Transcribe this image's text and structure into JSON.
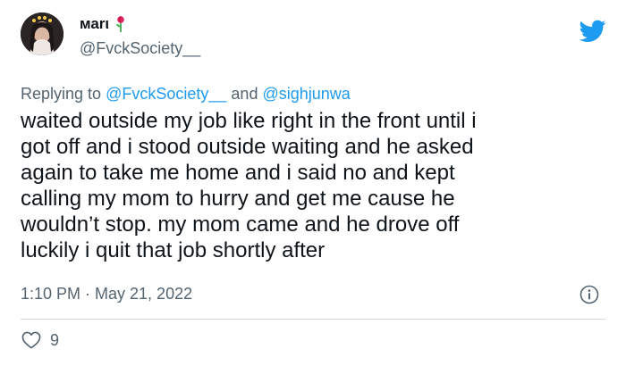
{
  "tweet": {
    "display_name": "маrι",
    "handle": "@FvckSociety__",
    "replying_prefix": "Replying to",
    "replying_to": [
      "@FvckSociety__",
      "and",
      "@sighjunwa"
    ],
    "text_lines": [
      "waited outside my job like right in the front until i",
      "got off and i stood outside waiting and he asked",
      "again to take me home and i said no and kept",
      "calling my mom to hurry and get me cause he",
      "wouldn’t stop. my mom came and he drove off",
      "luckily i quit that job shortly after"
    ],
    "timestamp": "1:10 PM · May 21, 2022",
    "likes": "9"
  },
  "icons": {
    "brand": "twitter-bird-icon",
    "info": "info-icon",
    "like": "heart-icon",
    "name_emoji": "rose-icon"
  },
  "colors": {
    "accent": "#1d9bf0",
    "text": "#0f1419",
    "secondary": "#536471",
    "divider": "#cfd9de"
  }
}
